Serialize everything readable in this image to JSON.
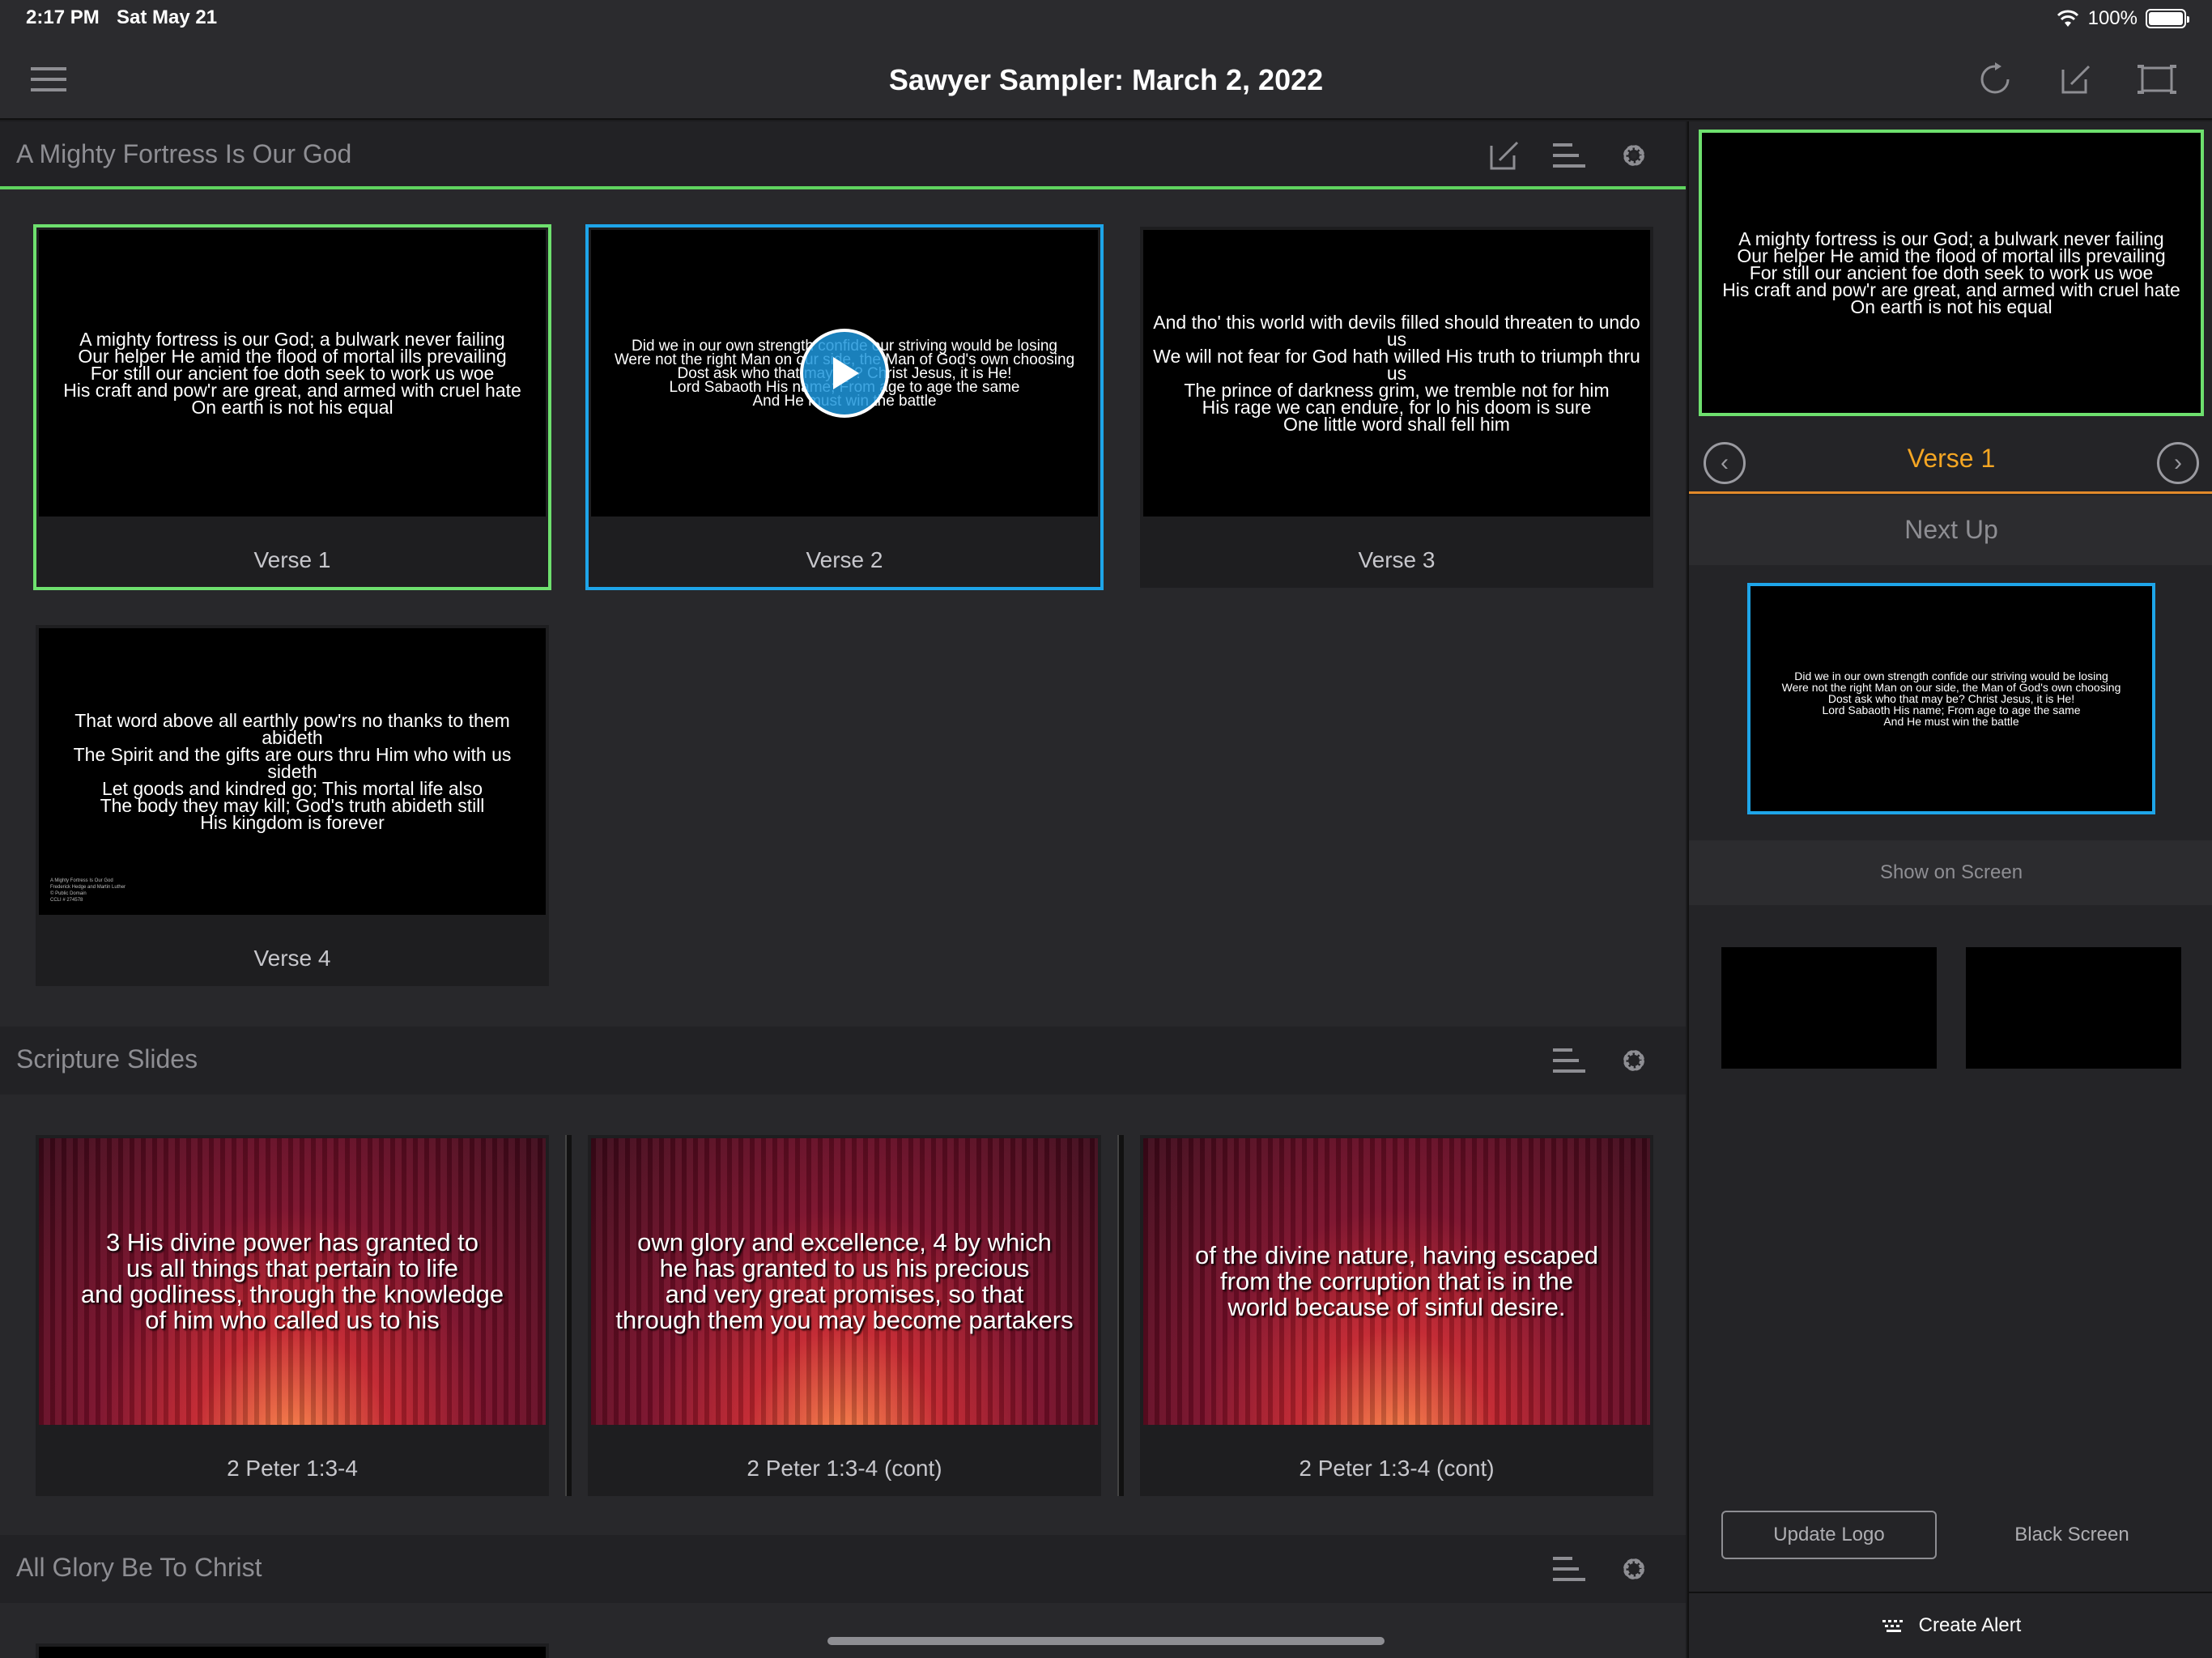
{
  "status": {
    "time": "2:17 PM",
    "date": "Sat May 21",
    "battery": "100%",
    "battery_level": 1.0
  },
  "nav": {
    "title": "Sawyer Sampler: March 2, 2022",
    "icons": [
      "menu-icon",
      "refresh-icon",
      "edit-icon",
      "screen-icon"
    ]
  },
  "sections": [
    {
      "title": "A Mighty Fortress Is Our God",
      "slides": [
        {
          "label": "Verse 1",
          "text": "A mighty fortress is our God; a bulwark never failing\nOur helper He amid the flood of mortal ills prevailing\nFor still our ancient foe doth seek to work us woe\nHis craft and pow'r are great, and armed with cruel hate\nOn earth is not his equal"
        },
        {
          "label": "Verse 2",
          "text": "Did we in our own strength confide our striving would be losing\nWere not the right Man on our side, the Man of God's own choosing\nDost ask who that may be? Christ Jesus, it is He!\nLord Sabaoth His name; From age to age the same\nAnd He must win the battle"
        },
        {
          "label": "Verse 3",
          "text": "And tho' this world with devils filled should threaten to undo us\nWe will not fear for God hath willed His truth to triumph thru us\nThe prince of darkness grim, we tremble not for him\nHis rage we can endure, for lo his doom is sure\nOne little word shall fell him"
        },
        {
          "label": "Verse 4",
          "text": "That word above all earthly pow'rs no thanks to them abideth\nThe Spirit and the gifts are ours thru Him who with us sideth\nLet goods and kindred go; This mortal life also\nThe body they may kill; God's truth abideth still\nHis kingdom is forever",
          "credit": "A Mighty Fortress Is Our God\nFrederick Hedge and Martin Luther\n© Public Domain\nCCLI # 274578"
        }
      ]
    },
    {
      "title": "Scripture Slides",
      "slides": [
        {
          "label": "2 Peter 1:3-4",
          "text": "3 His divine power has granted to\nus all things that pertain to life\nand godliness, through the knowledge\nof him who called us to his"
        },
        {
          "label": "2 Peter 1:3-4 (cont)",
          "text": "own glory and excellence, 4 by which\nhe has granted to us his precious\nand very great promises, so that\nthrough them you may become partakers"
        },
        {
          "label": "2 Peter 1:3-4 (cont)",
          "text": "of the divine nature, having escaped\nfrom the corruption that is in the\nworld because of sinful desire."
        }
      ]
    },
    {
      "title": "All Glory Be To Christ"
    }
  ],
  "side": {
    "current": "Verse 1",
    "current_text": "A mighty fortress is our God; a bulwark never failing\nOur helper He amid the flood of mortal ills prevailing\nFor still our ancient foe doth seek to work us woe\nHis craft and pow'r are great, and armed with cruel hate\nOn earth is not his equal",
    "next_up": "Next Up",
    "next_text": "Did we in our own strength confide our striving would be losing\nWere not the right Man on our side, the Man of God's own choosing\nDost ask who that may be? Christ Jesus, it is He!\nLord Sabaoth His name; From age to age the same\nAnd He must win the battle",
    "show_on_screen": "Show on Screen",
    "update_logo": "Update Logo",
    "black_screen": "Black Screen",
    "create_alert": "Create Alert"
  },
  "colors": {
    "live": "#6ee06e",
    "next": "#1ea5e9",
    "accent": "#f5a623"
  }
}
